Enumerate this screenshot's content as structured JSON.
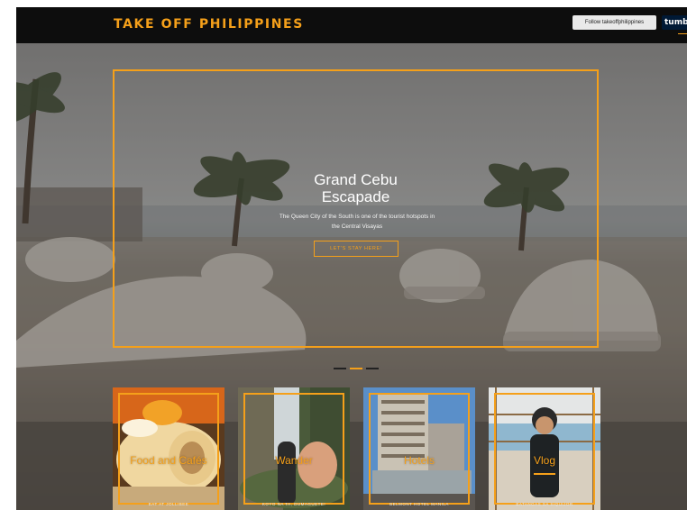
{
  "header": {
    "brand": "TAKE OFF PHILIPPINES",
    "follow_label": "Follow takeoffphilippines",
    "tumblr_label": "tumblr"
  },
  "hero": {
    "title_line1": "Grand Cebu",
    "title_line2": "Escapade",
    "subtitle": "The Queen City of the South is one of the tourist hotspots in the Central Visayas",
    "cta_label": "LET'S STAY HERE!",
    "slide_count": 3,
    "active_slide": 2
  },
  "cards": [
    {
      "title": "Food and Cafés",
      "caption": "EAT AT JOLLIBEE"
    },
    {
      "title": "Wander",
      "caption": "KOYO NA TA, DUMAGUETE!"
    },
    {
      "title": "Hotels",
      "caption": "BELMONT HOTEL MANILA"
    },
    {
      "title": "Vlog",
      "caption": "BATANGAS SA SIQUIJOR"
    }
  ],
  "colors": {
    "accent": "#f5a01a",
    "topbar": "#0d0d0d",
    "tumblr": "#001935"
  }
}
